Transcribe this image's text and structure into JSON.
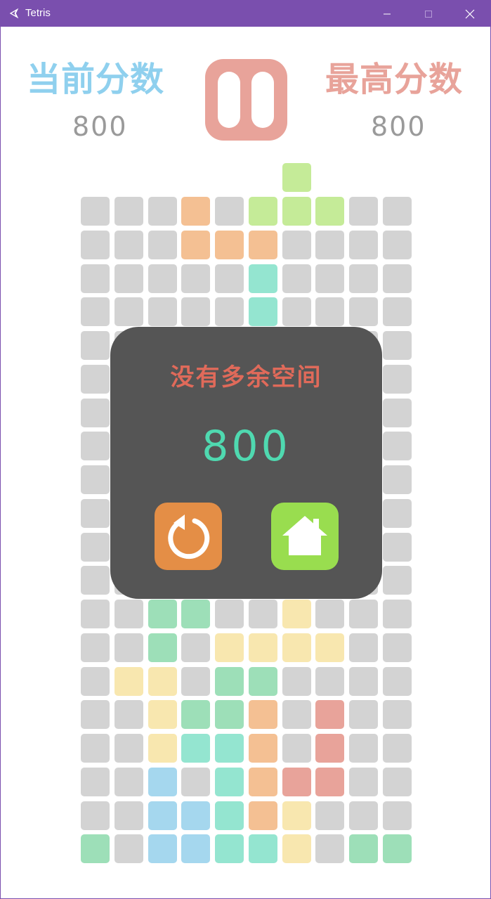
{
  "window": {
    "title": "Tetris",
    "accent": "#7a4fae"
  },
  "header": {
    "current_score_label": "当前分数",
    "current_score": "800",
    "high_score_label": "最高分数",
    "high_score": "800",
    "current_color": "#8fd0ee",
    "high_color": "#e8a39a"
  },
  "board": {
    "rows": 20,
    "cols": 10,
    "empty_color": "#d3d3d3",
    "palette": {
      "O": "#f4c093",
      "G": "#c5eb98",
      "T": "#94e5d0",
      "M": "#9ddfb8",
      "Y": "#f8e7af",
      "R": "#e8a39a",
      "B": "#a5d7ee"
    },
    "falling_piece": {
      "cells": [
        [
          -1,
          6
        ]
      ],
      "color": "#c5eb98"
    },
    "grid": [
      "...O.GGG..",
      "...OOO....",
      ".....T....",
      ".....T....",
      "..........",
      "..........",
      "..........",
      "..........",
      "..........",
      "..........",
      "..........",
      "..........",
      "..MM..Y...",
      "..M.YYYY..",
      ".YY.MM....",
      "..YMMO.R..",
      "..YTTO.R..",
      "..B.TORR..",
      "..BBTOY...",
      "M.BBTTY.MM"
    ]
  },
  "game_over": {
    "title": "没有多余空间",
    "score": "800",
    "restart_icon": "restart-icon",
    "home_icon": "home-icon",
    "restart_color": "#e48e46",
    "home_color": "#99dd4f"
  }
}
